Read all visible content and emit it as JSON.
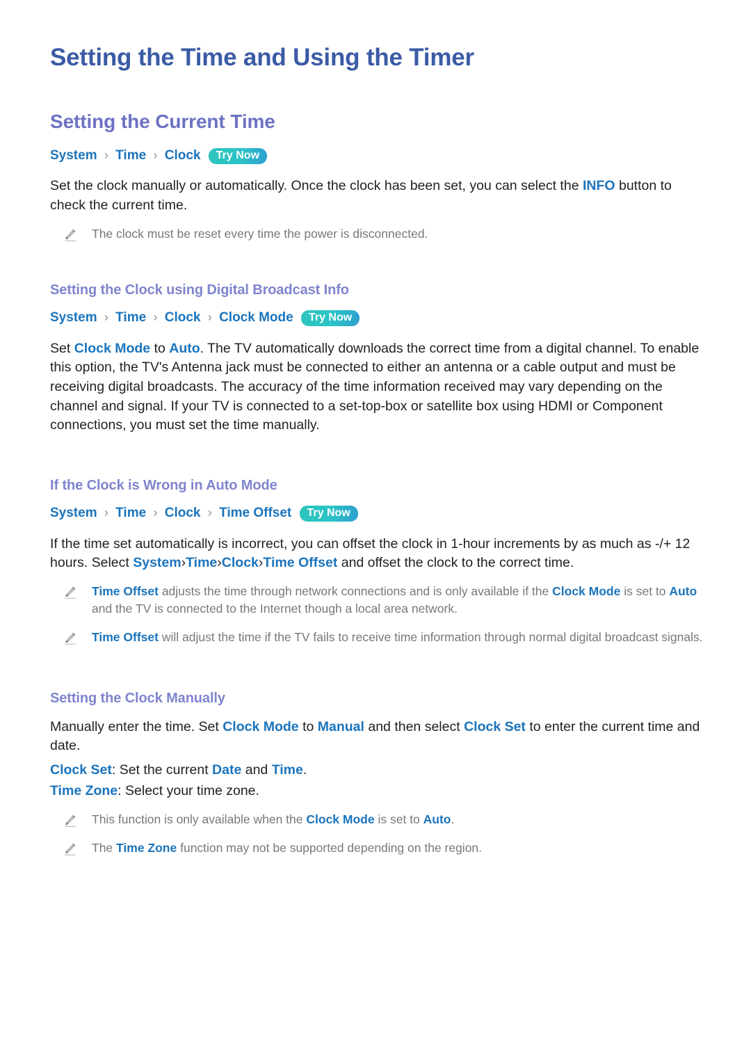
{
  "document": {
    "title": "Setting the Time and Using the Timer"
  },
  "icons": {
    "note": "pencil-icon"
  },
  "colors": {
    "h1": "#3b5ba5",
    "h2": "#6d72c3",
    "h3": "#7f84cd",
    "link": "#1b74bc",
    "body": "#231f20",
    "note": "#77787c",
    "badge_start": "#2ec4bd",
    "badge_end": "#2e9fd0"
  },
  "sections": {
    "current_time": {
      "heading": "Setting the Current Time",
      "breadcrumb": [
        "System",
        "Time",
        "Clock"
      ],
      "separator": "›",
      "try_now": "Try Now",
      "paragraph": {
        "a": "Set the clock manually or automatically. Once the clock has been set, you can select the ",
        "kw1": "INFO",
        "b": " button to check the current time."
      },
      "notes": [
        {
          "text": "The clock must be reset every time the power is disconnected."
        }
      ]
    },
    "digital_broadcast": {
      "heading": "Setting the Clock using Digital Broadcast Info",
      "breadcrumb": [
        "System",
        "Time",
        "Clock",
        "Clock Mode"
      ],
      "try_now": "Try Now",
      "paragraph": {
        "a": "Set ",
        "kw1": "Clock Mode",
        "b": " to ",
        "kw2": "Auto",
        "c": ". The TV automatically downloads the correct time from a digital channel. To enable this option, the TV's Antenna jack must be connected to either an antenna or a cable output and must be receiving digital broadcasts. The accuracy of the time information received may vary depending on the channel and signal. If your TV is connected to a set-top-box or satellite box using HDMI or Component connections, you must set the time manually."
      }
    },
    "clock_wrong": {
      "heading": "If the Clock is Wrong in Auto Mode",
      "breadcrumb": [
        "System",
        "Time",
        "Clock",
        "Time Offset"
      ],
      "try_now": "Try Now",
      "paragraph": {
        "a": "If the time set automatically is incorrect, you can offset the clock in 1-hour increments by as much as -/+ 12 hours. Select ",
        "kw1": "System",
        "b": "Time",
        "c": "Clock",
        "d": "Time Offset",
        "e": " and offset the clock to the correct time."
      },
      "notes": [
        {
          "a": "",
          "kw1": "Time Offset",
          "b": " adjusts the time through network connections and is only available if the ",
          "kw2": "Clock Mode",
          "c": " is set to ",
          "kw3": "Auto",
          "d": " and the TV is connected to the Internet though a local area network."
        },
        {
          "a": "",
          "kw1": "Time Offset",
          "b": " will adjust the time if the TV fails to receive time information through normal digital broadcast signals."
        }
      ]
    },
    "clock_manual": {
      "heading": "Setting the Clock Manually",
      "paragraph": {
        "a": "Manually enter the time. Set ",
        "kw1": "Clock Mode",
        "b": " to ",
        "kw2": "Manual",
        "c": " and then select ",
        "kw3": "Clock Set",
        "d": " to enter the current time and date."
      },
      "definitions": [
        {
          "term": "Clock Set",
          "a": ": Set the current ",
          "kw1": "Date",
          "b": " and ",
          "kw2": "Time",
          "c": "."
        },
        {
          "term": "Time Zone",
          "a": ": Select your time zone.",
          "kw1": "",
          "b": "",
          "kw2": "",
          "c": ""
        }
      ],
      "notes": [
        {
          "a": "This function is only available when the ",
          "kw1": "Clock Mode",
          "b": " is set to ",
          "kw2": "Auto",
          "c": "."
        },
        {
          "a": "The ",
          "kw1": "Time Zone",
          "b": " function may not be supported depending on the region."
        }
      ]
    }
  }
}
